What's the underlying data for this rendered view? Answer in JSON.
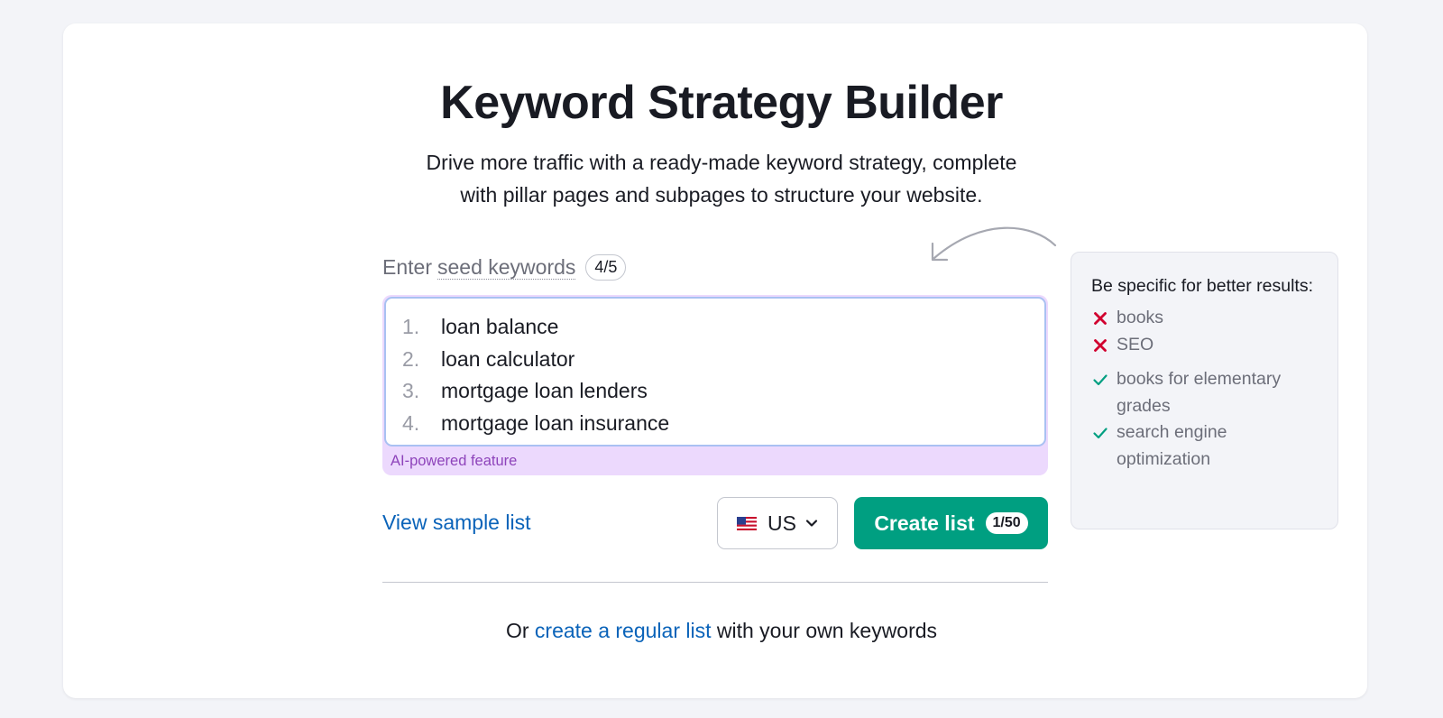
{
  "header": {
    "title": "Keyword Strategy Builder",
    "subtitle_line1": "Drive more traffic with a ready-made keyword strategy, complete",
    "subtitle_line2": "with pillar pages and subpages to structure your website."
  },
  "seed": {
    "label_prefix": "Enter",
    "label_link": "seed keywords",
    "count": "4/5",
    "keywords": [
      {
        "num": "1.",
        "text": "loan balance"
      },
      {
        "num": "2.",
        "text": "loan calculator"
      },
      {
        "num": "3.",
        "text": "mortgage loan lenders"
      },
      {
        "num": "4.",
        "text": "mortgage loan insurance"
      }
    ],
    "ai_label": "AI-powered feature"
  },
  "actions": {
    "sample_link": "View sample list",
    "country_code": "US",
    "create_label": "Create list",
    "create_count": "1/50"
  },
  "footer": {
    "prefix": "Or",
    "link": "create a regular list",
    "suffix": "with your own keywords"
  },
  "tips": {
    "title": "Be specific for better results:",
    "bad": [
      "books",
      "SEO"
    ],
    "good": [
      "books for elementary grades",
      "search engine optimization"
    ]
  },
  "colors": {
    "accent_green": "#009f81",
    "link_blue": "#0a63b9",
    "ai_purple": "#8e44bb",
    "bad_red": "#d1002f",
    "good_green": "#009f81"
  },
  "icons": {
    "bad": "x-icon",
    "good": "check-icon",
    "dropdown": "chevron-down-icon",
    "flag": "us-flag-icon",
    "hint": "curved-arrow-icon"
  }
}
